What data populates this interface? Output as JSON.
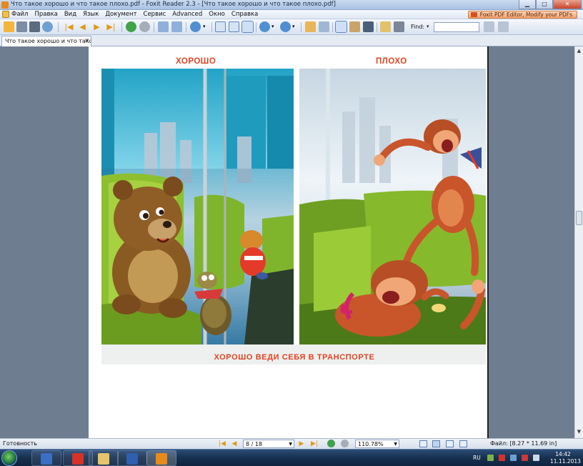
{
  "window": {
    "title": "Что такое хорошо и что такое плохо.pdf - Foxit Reader 2.3 - [Что такое хорошо и что такое плохо.pdf]",
    "minimize": "▁",
    "maximize": "□",
    "close": "✕"
  },
  "menu": {
    "items": [
      "Файл",
      "Правка",
      "Вид",
      "Язык",
      "Документ",
      "Сервис",
      "Advanced",
      "Окно",
      "Справка"
    ],
    "promo": "Foxit PDF Editor, Modify your PDFs"
  },
  "toolbar": {
    "find_label": "Find:",
    "find_dropdown": "▾",
    "find_value": ""
  },
  "tabs": {
    "doc_tab": "Что такое хорошо и что тако...",
    "close": "✕"
  },
  "page": {
    "label_good": "ХОРОШО",
    "label_bad": "ПЛОХО",
    "caption": "ХОРОШО ВЕДИ СЕБЯ В ТРАНСПОРТЕ"
  },
  "statusbar": {
    "status": "Готовность",
    "page_field": "8 / 18",
    "zoom": "110.78%",
    "file_size": "Файл: [8.27 * 11.69 in]",
    "first": "|◀",
    "prev": "◀",
    "next": "▶",
    "last": "▶|"
  },
  "scrollbar": {
    "up": "▲",
    "down": "▼"
  },
  "taskbar": {
    "lang": "RU",
    "time": "14:42",
    "date": "11.11.2013"
  },
  "colors": {
    "accent_red": "#e34322",
    "nav_orange": "#e09a14",
    "taskbar": "#17304f"
  }
}
